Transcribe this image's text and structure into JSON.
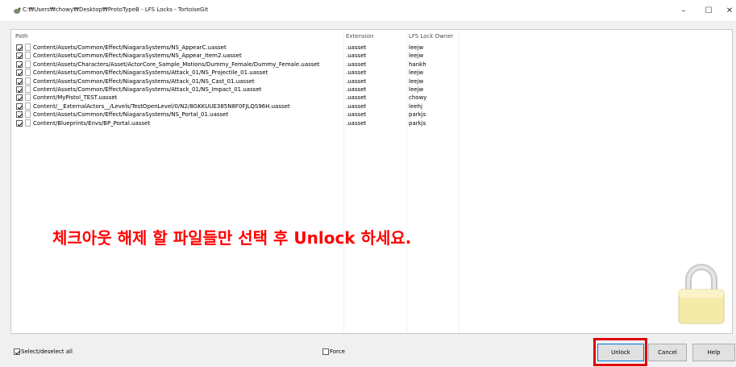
{
  "window": {
    "title": "C:₩Users₩chowy₩Desktop₩ProtoTypeB - LFS Locks - TortoiseGit",
    "minimize_glyph": "–",
    "maximize_glyph": "☐",
    "close_glyph": "✕"
  },
  "list": {
    "columns": {
      "path": "Path",
      "extension": "Extension",
      "owner": "LFS Lock Owner"
    },
    "rows": [
      {
        "path": "Content/Assets/Common/Effect/NiagaraSystems/NS_AppearC.uasset",
        "ext": ".uasset",
        "owner": "leejw",
        "checked": true
      },
      {
        "path": "Content/Assets/Common/Effect/NiagaraSystems/NS_Appear_Item2.uasset",
        "ext": ".uasset",
        "owner": "leejw",
        "checked": true
      },
      {
        "path": "Content/Assets/Characters/Asset/ActorCore_Sample_Motions/Dummy_Female/Dummy_Female.uasset",
        "ext": ".uasset",
        "owner": "hankh",
        "checked": true
      },
      {
        "path": "Content/Assets/Common/Effect/NiagaraSystems/Attack_01/NS_Projectile_01.uasset",
        "ext": ".uasset",
        "owner": "leejw",
        "checked": true
      },
      {
        "path": "Content/Assets/Common/Effect/NiagaraSystems/Attack_01/NS_Cast_01.uasset",
        "ext": ".uasset",
        "owner": "leejw",
        "checked": true
      },
      {
        "path": "Content/Assets/Common/Effect/NiagaraSystems/Attack_01/NS_Impact_01.uasset",
        "ext": ".uasset",
        "owner": "leejw",
        "checked": true
      },
      {
        "path": "Content/MyPistol_TEST.uasset",
        "ext": ".uasset",
        "owner": "chowy",
        "checked": true
      },
      {
        "path": "Content/__ExternalActors__/Levels/TestOpenLevel/0/N2/8GKKUUE385N8F0FJLQS96H.uasset",
        "ext": ".uasset",
        "owner": "leehj",
        "checked": true
      },
      {
        "path": "Content/Assets/Common/Effect/NiagaraSystems/NS_Portal_01.uasset",
        "ext": ".uasset",
        "owner": "parkjs",
        "checked": true
      },
      {
        "path": "Content/Blueprints/Envs/BP_Portal.uasset",
        "ext": ".uasset",
        "owner": "parkjs",
        "checked": true
      }
    ]
  },
  "instruction": "체크아웃 해제 할 파일들만 선택 후 Unlock 하세요.",
  "footer": {
    "select_all_label": "Select/deselect all",
    "select_all_checked": true,
    "force_label": "Force",
    "force_checked": false,
    "unlock_label": "Unlock",
    "cancel_label": "Cancel",
    "help_label": "Help"
  },
  "colors": {
    "accent_highlight": "#e00000",
    "instruction_text": "#ff0000",
    "lock_body": "#f5eba8",
    "lock_shackle": "#c9c9c9"
  },
  "icons": {
    "app": "tortoisegit-icon",
    "file": "file-icon",
    "lock": "padlock-icon"
  }
}
